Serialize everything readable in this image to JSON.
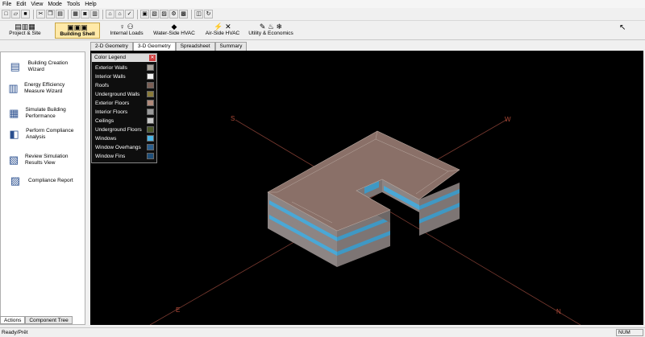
{
  "menu": [
    "File",
    "Edit",
    "View",
    "Mode",
    "Tools",
    "Help"
  ],
  "toolbar_icons": [
    "new-file-icon",
    "open-folder-icon",
    "save-icon",
    "cut-icon",
    "copy-icon",
    "paste-icon",
    "print-icon",
    "print-preview-icon",
    "building-icon",
    "building-zones-icon",
    "building-shell-icon",
    "check-icon",
    "wall-icon",
    "window-icon",
    "shading-icon",
    "settings-icon",
    "grid-icon",
    "export-icon"
  ],
  "ribbon": [
    {
      "label": "Project & Site",
      "icon": "project-site-icon"
    },
    {
      "label": "Building Shell",
      "icon": "building-shell-icon",
      "active": true
    },
    {
      "label": "Internal Loads",
      "icon": "internal-loads-icon"
    },
    {
      "label": "Water-Side HVAC",
      "icon": "water-side-hvac-icon"
    },
    {
      "label": "Air-Side HVAC",
      "icon": "air-side-hvac-icon"
    },
    {
      "label": "Utility & Economics",
      "icon": "utility-economics-icon"
    }
  ],
  "actions": [
    {
      "label": "Building Creation Wizard",
      "icon": "wizard-icon"
    },
    {
      "label": "Energy Efficiency Measure Wizard",
      "icon": "efficiency-wizard-icon"
    },
    {
      "label": "Simulate Building Performance",
      "icon": "simulate-icon"
    },
    {
      "label": "Perform Compliance Analysis",
      "icon": "compliance-analysis-icon"
    },
    {
      "label": "Review Simulation Results View",
      "icon": "results-view-icon"
    },
    {
      "label": "Compliance Report",
      "icon": "compliance-report-icon"
    }
  ],
  "left_tabs": [
    "Actions",
    "Component Tree"
  ],
  "view_tabs": [
    "2-D Geometry",
    "3-D Geometry",
    "Spreadsheet",
    "Summary"
  ],
  "active_view_tab": "3-D Geometry",
  "legend": {
    "title": "Color Legend",
    "items": [
      {
        "label": "Exterior Walls",
        "color": "#a9a29a"
      },
      {
        "label": "Interior Walls",
        "color": "#f4f4f4"
      },
      {
        "label": "Roofs",
        "color": "#7a5f55"
      },
      {
        "label": "Underground Walls",
        "color": "#8a7b3a"
      },
      {
        "label": "Exterior Floors",
        "color": "#b0897a"
      },
      {
        "label": "Interior Floors",
        "color": "#9a9a9a"
      },
      {
        "label": "Ceilings",
        "color": "#c8c8c8"
      },
      {
        "label": "Underground Floors",
        "color": "#4d5a2a"
      },
      {
        "label": "Windows",
        "color": "#4cb6e6"
      },
      {
        "label": "Window Overhangs",
        "color": "#2b5f8e"
      },
      {
        "label": "Window Fins",
        "color": "#1f4f7a"
      }
    ]
  },
  "compass": {
    "s": "S",
    "w": "W",
    "e": "E",
    "n": "N"
  },
  "status": {
    "text": "Ready/Prêt",
    "num": "NUM"
  },
  "colors": {
    "roof": "#8a7068",
    "wall_band": "#8d8584",
    "window": "#4aa8d6",
    "axis": "#7a3a30",
    "label": "#b04a38"
  }
}
